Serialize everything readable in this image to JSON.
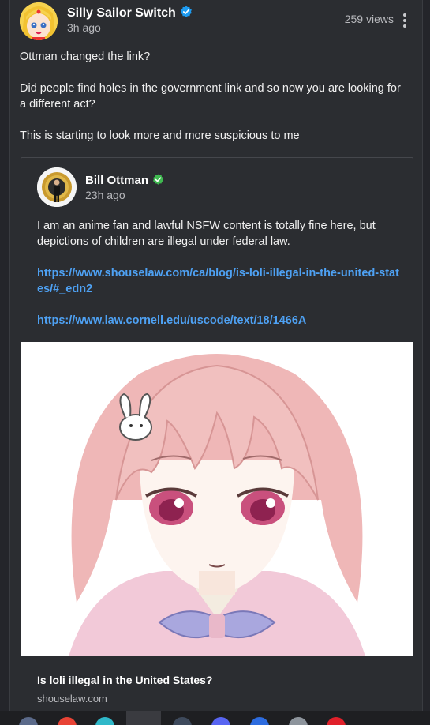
{
  "post": {
    "author": "Silly Sailor Switch",
    "author_verified_icon": "verified-check-icon",
    "time": "3h ago",
    "views": "259 views",
    "menu_icon": "more-vertical-icon",
    "paragraphs": [
      "Ottman changed the link?",
      "Did people find holes in the government link and so now you are looking for a different act?",
      "This is starting to look more and more suspicious to me"
    ]
  },
  "quoted": {
    "author": "Bill Ottman",
    "author_verified_icon": "verified-check-icon",
    "time": "23h ago",
    "text": "I am an anime fan and lawful NSFW content is totally fine here, but depictions of children are illegal under federal law.",
    "links": [
      "https://www.shouselaw.com/ca/blog/is-loli-illegal-in-the-united-states/#_edn2",
      "https://www.law.cornell.edu/uscode/text/18/1466A"
    ],
    "preview": {
      "title": "Is loli illegal in the United States?",
      "domain": "shouselaw.com"
    }
  },
  "taskbar_icons": [
    "app-icon",
    "chrome-icon",
    "edge-icon",
    "app-icon",
    "steam-icon",
    "discord-icon",
    "app-icon",
    "app-icon",
    "opera-icon"
  ],
  "colors": {
    "background": "#24252a",
    "card": "#2b2d31",
    "link": "#4ea1f3",
    "verified_blue": "#1d9bf0",
    "verified_green": "#3fb950"
  }
}
